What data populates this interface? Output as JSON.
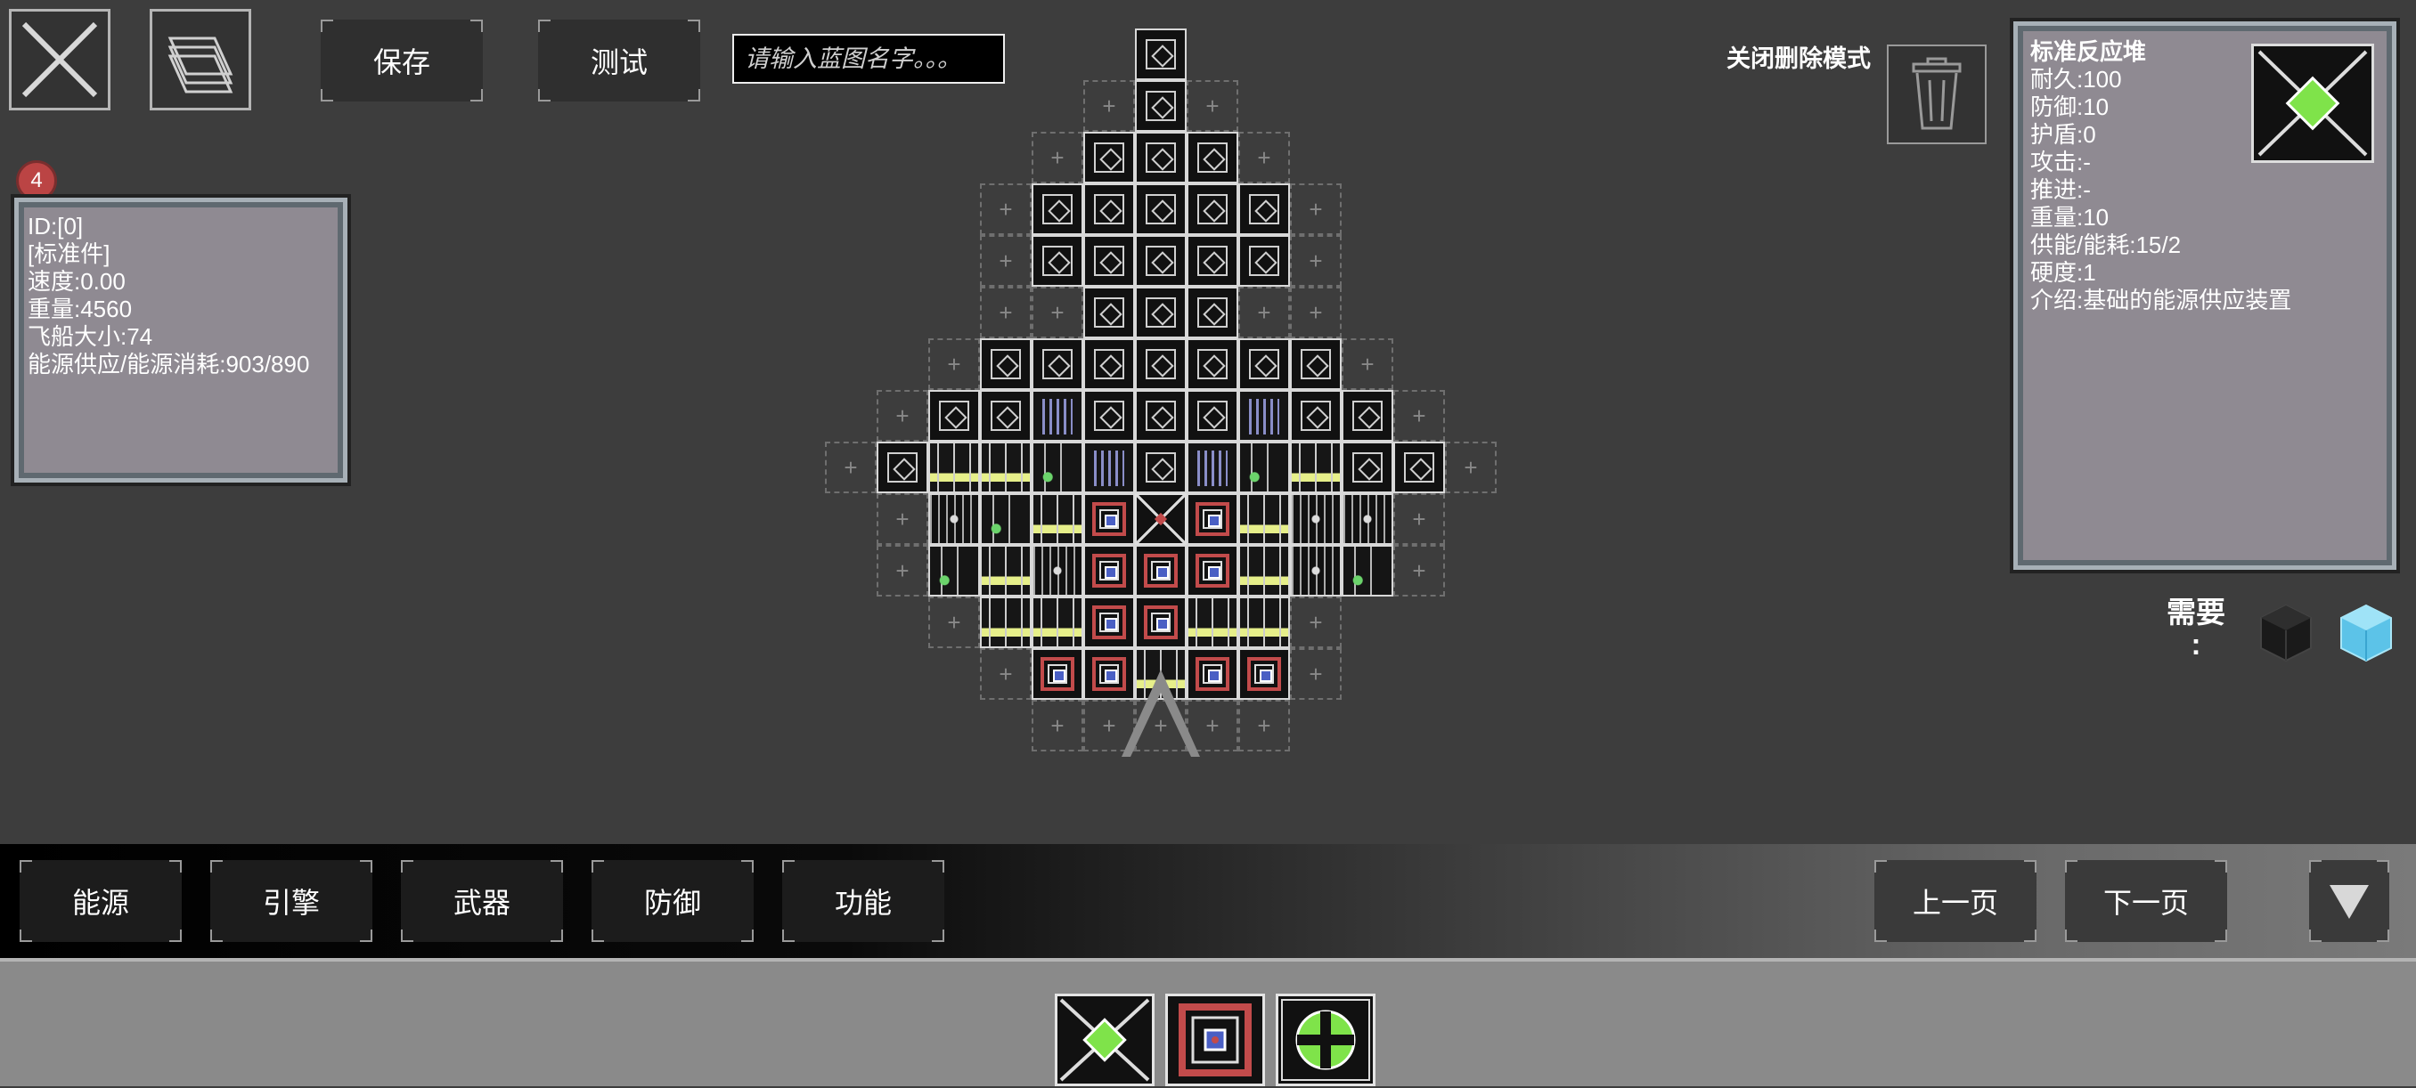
{
  "toolbar": {
    "save_label": "保存",
    "test_label": "测试",
    "name_placeholder": "请输入蓝图名字。。。",
    "delete_mode_label": "关闭删除模式"
  },
  "badge": {
    "count": "4"
  },
  "ship_stats": {
    "lines": [
      "ID:[0]",
      "[标准件]",
      "速度:0.00",
      "重量:4560",
      "飞船大小:74",
      "能源供应/能源消耗:903/890"
    ]
  },
  "part_info": {
    "lines": [
      "标准反应堆",
      "耐久:100",
      "防御:10",
      "护盾:0",
      "攻击:-",
      "推进:-",
      "重量:10",
      "供能/能耗:15/2",
      "硬度:1",
      "介绍:基础的能源供应装置"
    ]
  },
  "requirements": {
    "label": "需要\n:"
  },
  "categories": [
    "能源",
    "引擎",
    "武器",
    "防御",
    "功能"
  ],
  "paging": {
    "prev_label": "上一页",
    "next_label": "下一页"
  },
  "tray_items": [
    "standard-reactor",
    "red-defense-module",
    "green-cross-module"
  ],
  "colors": {
    "background": "#3d3d3d",
    "panel": "#8f8a92",
    "accent_green": "#7fe34a",
    "accent_red": "#c24b4b",
    "accent_blue": "#4a5fc4",
    "ice": "#7ad3ef"
  }
}
